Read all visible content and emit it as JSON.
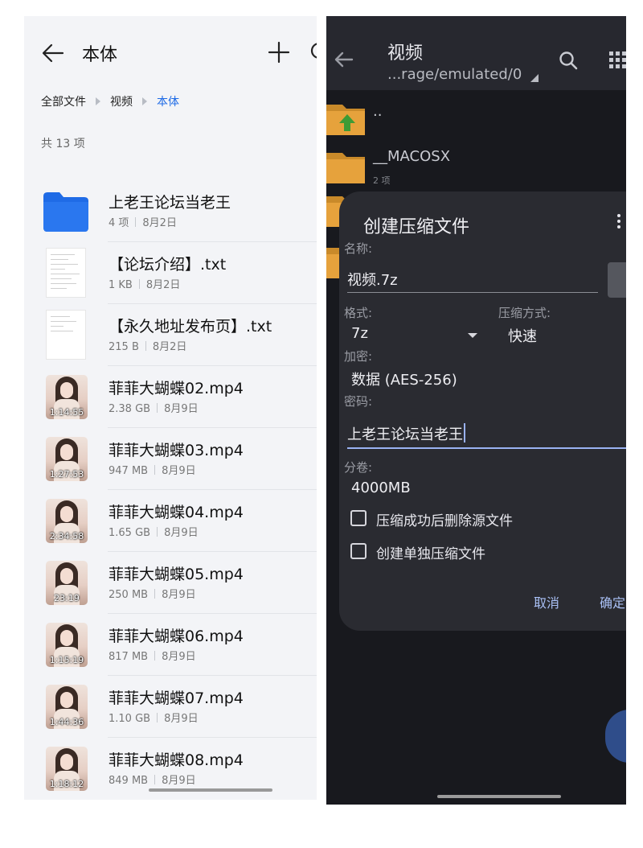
{
  "left": {
    "header": {
      "title": "本体"
    },
    "breadcrumb": [
      "全部文件",
      "视频",
      "本体"
    ],
    "count_label": "共 13 项",
    "files": [
      {
        "name": "上老王论坛当老王",
        "size": "4 项",
        "date": "8月2日",
        "kind": "folder"
      },
      {
        "name": "【论坛介绍】.txt",
        "size": "1 KB",
        "date": "8月2日",
        "kind": "txt"
      },
      {
        "name": "【永久地址发布页】.txt",
        "size": "215 B",
        "date": "8月2日",
        "kind": "txt"
      },
      {
        "name": "菲菲大蝴蝶02.mp4",
        "size": "2.38 GB",
        "date": "8月9日",
        "kind": "video",
        "duration": "1:14:55"
      },
      {
        "name": "菲菲大蝴蝶03.mp4",
        "size": "947 MB",
        "date": "8月9日",
        "kind": "video",
        "duration": "1:27:53"
      },
      {
        "name": "菲菲大蝴蝶04.mp4",
        "size": "1.65 GB",
        "date": "8月9日",
        "kind": "video",
        "duration": "2:34:58"
      },
      {
        "name": "菲菲大蝴蝶05.mp4",
        "size": "250 MB",
        "date": "8月9日",
        "kind": "video",
        "duration": "23:19"
      },
      {
        "name": "菲菲大蝴蝶06.mp4",
        "size": "817 MB",
        "date": "8月9日",
        "kind": "video",
        "duration": "1:15:19"
      },
      {
        "name": "菲菲大蝴蝶07.mp4",
        "size": "1.10 GB",
        "date": "8月9日",
        "kind": "video",
        "duration": "1:44:36"
      },
      {
        "name": "菲菲大蝴蝶08.mp4",
        "size": "849 MB",
        "date": "8月9日",
        "kind": "video",
        "duration": "1:18:12"
      }
    ]
  },
  "right": {
    "header": {
      "title": "视频",
      "path": "...rage/emulated/0"
    },
    "list": [
      {
        "name": "..",
        "detail": ""
      },
      {
        "name": "__MACOSX",
        "detail": "2 项"
      }
    ],
    "dialog": {
      "title": "创建压缩文件",
      "name_label": "名称:",
      "name_value": "视频.7z",
      "format_label": "格式:",
      "format_value": "7z",
      "method_label": "压缩方式:",
      "method_value": "快速",
      "encrypt_label": "加密:",
      "encrypt_value": "数据 (AES-256)",
      "password_label": "密码:",
      "password_value": "上老王论坛当老王",
      "split_label": "分卷:",
      "split_value": "4000MB",
      "delete_source_label": "压缩成功后删除源文件",
      "delete_source_checked": false,
      "separate_label": "创建单独压缩文件",
      "separate_checked": false,
      "cancel_label": "取消",
      "ok_label": "确定"
    }
  },
  "colors": {
    "accent_blue": "#1f6be6",
    "folder_blue": "#1f6be6",
    "dialog_bg": "#2a2b31",
    "dark_bg": "#18191e",
    "button_text": "#a9c0f5"
  }
}
